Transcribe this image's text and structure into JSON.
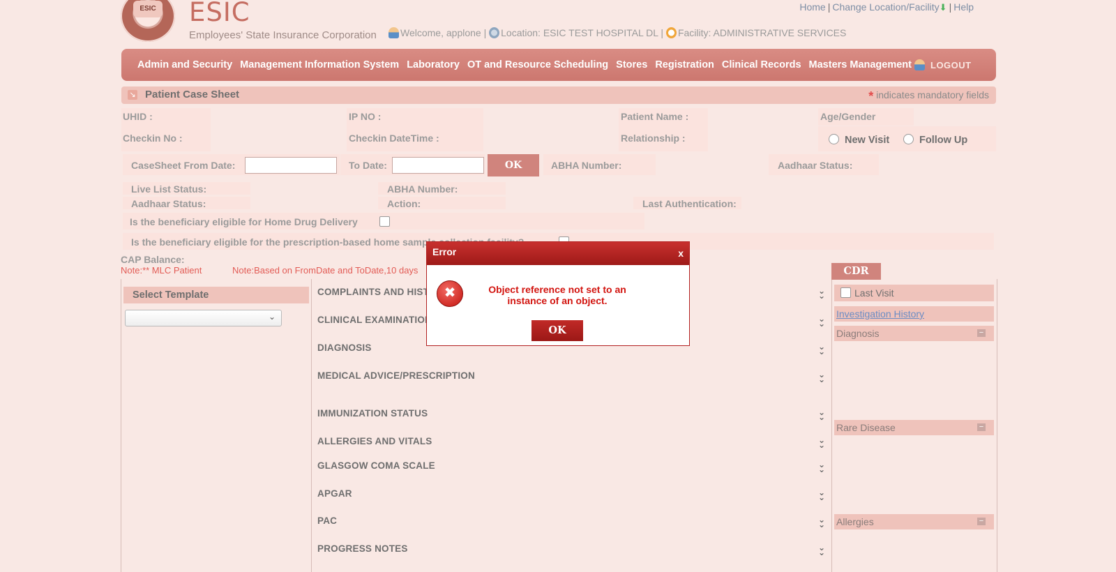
{
  "header": {
    "logo_text": "ESIC",
    "brand_name": "ESIC",
    "brand_tagline": "Employees' State Insurance Corporation",
    "links": {
      "home": "Home",
      "change": "Change Location/Facility",
      "help": "Help"
    },
    "welcome": "Welcome, applone |",
    "location": "Location: ESIC TEST HOSPITAL DL |",
    "facility": "Facility: ADMINISTRATIVE SERVICES"
  },
  "nav": {
    "items": [
      "Admin and Security",
      "Management Information System",
      "Laboratory",
      "OT and Resource Scheduling",
      "Stores",
      "Registration",
      "Clinical Records",
      "Masters Management"
    ],
    "logout": "LOGOUT"
  },
  "titlebar": {
    "title": "Patient Case Sheet",
    "star": "*",
    "mandatory": "indicates mandatory fields"
  },
  "patient": {
    "uhid": "UHID :",
    "ipno": "IP NO :",
    "name": "Patient Name :",
    "age_gender": "Age/Gender",
    "checkin_no": "Checkin No :",
    "checkin_dt": "Checkin DateTime :",
    "relationship": "Relationship :",
    "new_visit": "New Visit",
    "follow_up": "Follow Up"
  },
  "dates": {
    "from_label": "CaseSheet From Date:",
    "to_label": "To Date:",
    "ok": "OK",
    "abha": "ABHA Number:",
    "aadhaar": "Aadhaar Status:"
  },
  "status": {
    "live_list": "Live List Status:",
    "abha": "ABHA Number:",
    "aadhaar": "Aadhaar Status:",
    "action": "Action:",
    "last_auth": "Last Authentication:"
  },
  "eligibility": {
    "home_drug": "Is the beneficiary eligible for Home Drug Delivery",
    "home_sample": "Is the beneficiary eligible for the prescription-based home sample collection facility?"
  },
  "notes": {
    "cap_balance": "CAP Balance:",
    "mlc": "Note:** MLC Patient",
    "date_note": "Note:Based on FromDate and ToDate,10 days"
  },
  "template": {
    "label": "Select Template"
  },
  "sections": [
    "COMPLAINTS AND HISTORY",
    "CLINICAL EXAMINATION",
    "DIAGNOSIS",
    "MEDICAL ADVICE/PRESCRIPTION",
    "IMMUNIZATION STATUS",
    "ALLERGIES AND VITALS",
    "GLASGOW COMA SCALE",
    "APGAR",
    "PAC",
    "PROGRESS NOTES"
  ],
  "cdr": {
    "tab": "CDR",
    "last_visit": "Last Visit",
    "investigation": "Investigation History",
    "diagnosis": "Diagnosis",
    "rare_disease": "Rare Disease",
    "allergies": "Allergies"
  },
  "modal": {
    "title": "Error",
    "close": "x",
    "message": "Object reference not set to an instance of an object.",
    "ok": "OK"
  }
}
